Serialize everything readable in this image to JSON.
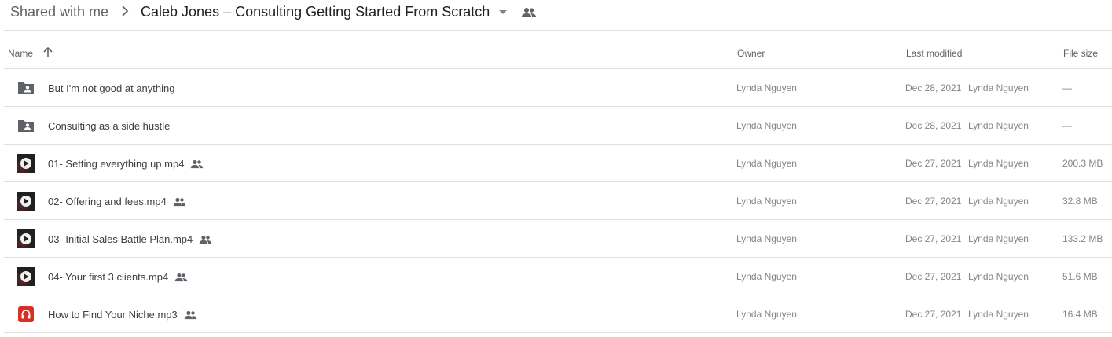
{
  "breadcrumb": {
    "root": "Shared with me",
    "current": "Caleb Jones – Consulting Getting Started From Scratch"
  },
  "columns": {
    "name": "Name",
    "owner": "Owner",
    "last_modified": "Last modified",
    "file_size": "File size"
  },
  "rows": [
    {
      "icon": "shared-folder-icon",
      "name": "But I'm not good at anything",
      "shared": false,
      "owner": "Lynda Nguyen",
      "modified_date": "Dec 28, 2021",
      "modified_by": "Lynda Nguyen",
      "size": "—"
    },
    {
      "icon": "shared-folder-icon",
      "name": "Consulting as a side hustle",
      "shared": false,
      "owner": "Lynda Nguyen",
      "modified_date": "Dec 28, 2021",
      "modified_by": "Lynda Nguyen",
      "size": "—"
    },
    {
      "icon": "video-icon",
      "name": "01- Setting everything up.mp4",
      "shared": true,
      "owner": "Lynda Nguyen",
      "modified_date": "Dec 27, 2021",
      "modified_by": "Lynda Nguyen",
      "size": "200.3 MB"
    },
    {
      "icon": "video-icon",
      "name": "02- Offering and fees.mp4",
      "shared": true,
      "owner": "Lynda Nguyen",
      "modified_date": "Dec 27, 2021",
      "modified_by": "Lynda Nguyen",
      "size": "32.8 MB"
    },
    {
      "icon": "video-icon",
      "name": "03- Initial Sales Battle Plan.mp4",
      "shared": true,
      "owner": "Lynda Nguyen",
      "modified_date": "Dec 27, 2021",
      "modified_by": "Lynda Nguyen",
      "size": "133.2 MB"
    },
    {
      "icon": "video-icon",
      "name": "04- Your first 3 clients.mp4",
      "shared": true,
      "owner": "Lynda Nguyen",
      "modified_date": "Dec 27, 2021",
      "modified_by": "Lynda Nguyen",
      "size": "51.6 MB"
    },
    {
      "icon": "audio-icon",
      "name": "How to Find Your Niche.mp3",
      "shared": true,
      "owner": "Lynda Nguyen",
      "modified_date": "Dec 27, 2021",
      "modified_by": "Lynda Nguyen",
      "size": "16.4 MB"
    }
  ],
  "colors": {
    "text_primary": "#202124",
    "text_secondary": "#5f6368",
    "text_muted": "#80868b",
    "divider": "#e0e0e0",
    "audio_icon": "#d93025"
  }
}
